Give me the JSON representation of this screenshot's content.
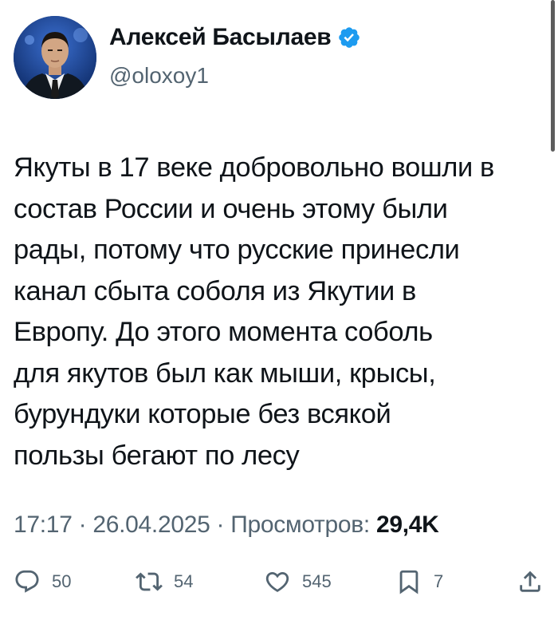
{
  "author": {
    "name": "Алексей Басылаев",
    "handle": "@oloxoy1",
    "verified": true,
    "verified_color": "#1d9bf0"
  },
  "tweet": {
    "lines": [
      "Якуты в 17 веке добровольно вошли в",
      "состав России и очень этому были",
      "рады, потому что русские принесли",
      "канал сбыта соболя из Якутии в",
      "Европу. До этого момента соболь",
      "для якутов был как мыши, крысы,",
      "бурундуки которые без всякой",
      "пользы бегают по лесу"
    ]
  },
  "meta": {
    "time": "17:17",
    "separator": " · ",
    "date": "26.04.2025",
    "views_label": "Просмотров: ",
    "views_count": "29,4K"
  },
  "actions": {
    "replies": {
      "icon": "reply-icon",
      "count": "50"
    },
    "reposts": {
      "icon": "repost-icon",
      "count": "54"
    },
    "likes": {
      "icon": "heart-icon",
      "count": "545"
    },
    "bookmarks": {
      "icon": "bookmark-icon",
      "count": "7"
    },
    "share": {
      "icon": "share-icon"
    }
  }
}
